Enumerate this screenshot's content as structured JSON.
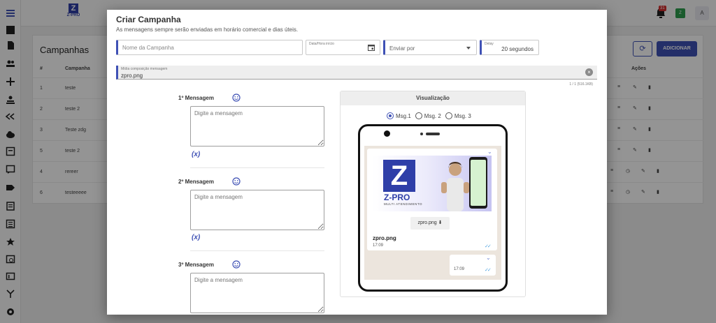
{
  "app": {
    "logo_text": "Z-PRO",
    "notification_count": "31",
    "user_initial": "A",
    "status_badge": "Z",
    "accent_color": "#3f51b5"
  },
  "sidebar": {
    "icons": [
      "menu-icon",
      "dashboard-icon",
      "document-icon",
      "contacts-icon",
      "connections-icon",
      "queue-icon",
      "reply-icon",
      "cloud-icon",
      "tag-icon",
      "chat-icon",
      "label-icon",
      "copy-icon",
      "list-icon",
      "star-icon",
      "schedule-icon",
      "campaign-icon",
      "flow-icon",
      "settings-icon"
    ]
  },
  "background_page": {
    "title": "Campanhas",
    "columns": {
      "id": "#",
      "name": "Campanha",
      "actions": "Ações"
    },
    "rows": [
      {
        "id": "1",
        "name": "teste"
      },
      {
        "id": "2",
        "name": "teste 2"
      },
      {
        "id": "3",
        "name": "Teste zdg"
      },
      {
        "id": "5",
        "name": "teste 2"
      },
      {
        "id": "4",
        "name": "rereer"
      },
      {
        "id": "6",
        "name": "testeeeee"
      }
    ],
    "add_label": "ADICIONAR"
  },
  "modal": {
    "title": "Criar Campanha",
    "subtitle": "As mensagens sempre serão enviadas em horário comercial e dias úteis.",
    "campaign_name_placeholder": "Nome da Campanha",
    "start_date_label": "Data/Hora início",
    "send_by_placeholder": "Enviar por",
    "delay_label": "Delay",
    "delay_value": "20 segundos",
    "media_label": "Mídia composição mensagem",
    "media_value": "zpro.png",
    "media_count": "1 / 1 (516.1KB)",
    "messages": [
      {
        "label": "1º Mensagem",
        "placeholder": "Digite a mensagem",
        "var": "(x)"
      },
      {
        "label": "2º Mensagem",
        "placeholder": "Digite a mensagem",
        "var": "(x)"
      },
      {
        "label": "3º Mensagem",
        "placeholder": "Digite a mensagem"
      }
    ]
  },
  "preview": {
    "title": "Visualização",
    "options": [
      "Msg.1",
      "Msg. 2",
      "Msg. 3"
    ],
    "selected": "Msg.1",
    "banner_title": "Z-PRO",
    "banner_subtitle": "MULTI ATENDIMENTO",
    "download_label": "zpro.png",
    "file_name": "zpro.png",
    "time_1": "17:09",
    "time_2": "17:09"
  }
}
